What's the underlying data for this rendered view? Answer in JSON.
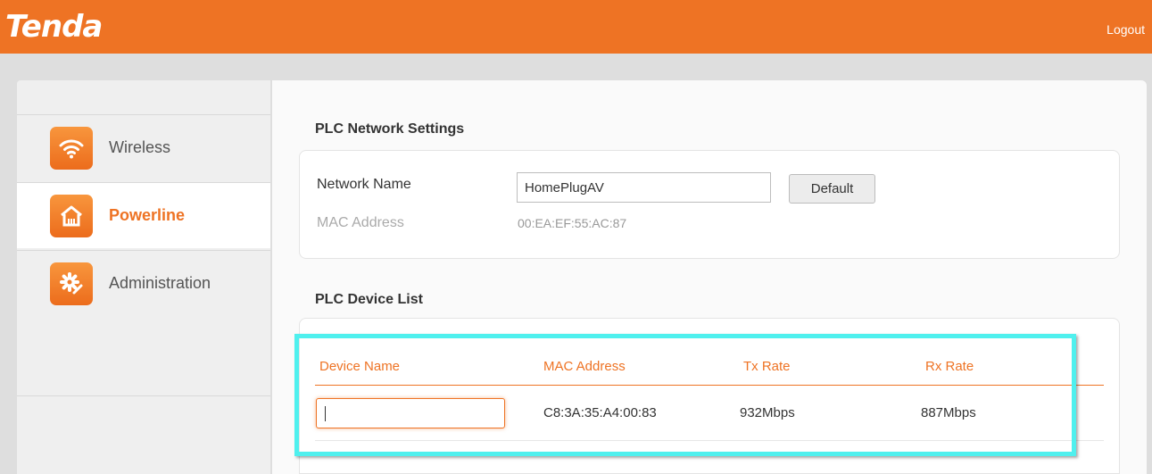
{
  "header": {
    "logo": "Tenda",
    "logout_label": "Logout"
  },
  "sidebar": {
    "items": [
      {
        "label": "Wireless",
        "icon": "wifi-icon",
        "active": false
      },
      {
        "label": "Powerline",
        "icon": "home-icon",
        "active": true
      },
      {
        "label": "Administration",
        "icon": "gear-icon",
        "active": false
      }
    ]
  },
  "network_settings": {
    "title": "PLC Network Settings",
    "network_name_label": "Network Name",
    "network_name_value": "HomePlugAV",
    "default_button": "Default",
    "mac_label": "MAC Address",
    "mac_value": "00:EA:EF:55:AC:87"
  },
  "device_list": {
    "title": "PLC Device List",
    "columns": [
      "Device Name",
      "MAC Address",
      "Tx Rate",
      "Rx Rate"
    ],
    "rows": [
      {
        "device_name": "",
        "mac": "C8:3A:35:A4:00:83",
        "tx": "932Mbps",
        "rx": "887Mbps"
      }
    ]
  },
  "colors": {
    "brand": "#ee7324",
    "highlight": "#4ff0ee"
  }
}
